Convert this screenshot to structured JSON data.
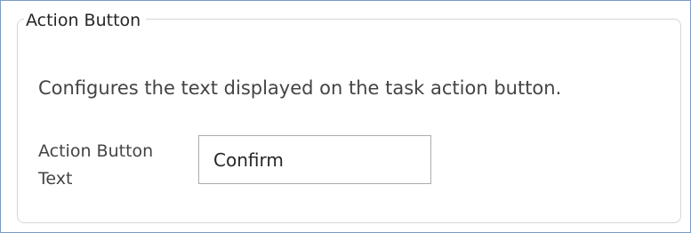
{
  "section": {
    "title": "Action Button",
    "description": "Configures the text displayed on the task action button."
  },
  "action_button_text": {
    "label": "Action Button Text",
    "value": "Confirm"
  }
}
